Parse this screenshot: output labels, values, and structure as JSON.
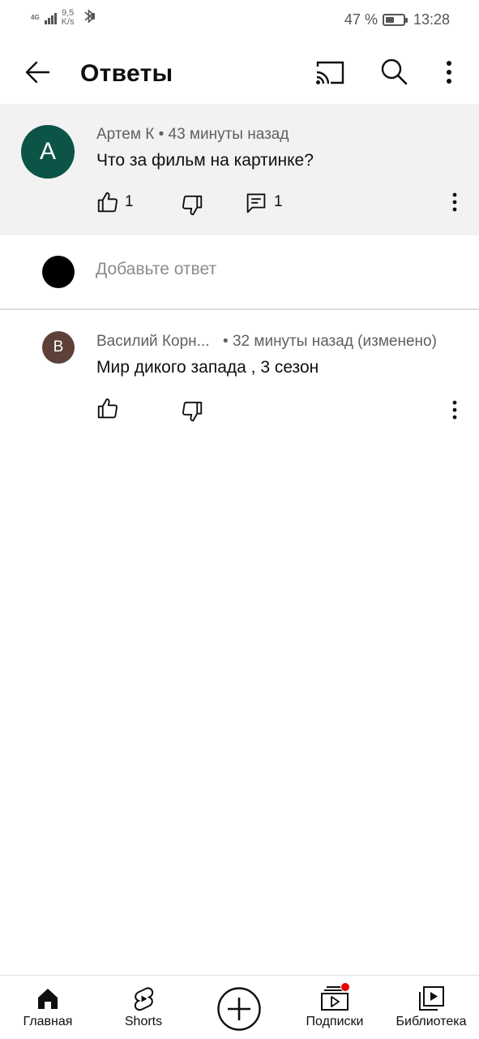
{
  "status_bar": {
    "network": "4G",
    "speed_value": "9,5",
    "speed_unit": "K/s",
    "battery": "47 %",
    "battery_level": 0.47,
    "time": "13:28"
  },
  "app_bar": {
    "title": "Ответы",
    "icons": [
      "back-arrow-icon",
      "cast-icon",
      "search-icon",
      "more-vert-icon"
    ]
  },
  "parent_comment": {
    "avatar_letter": "А",
    "avatar_color": "#0c5447",
    "author": "Артем К",
    "time": "43 минуты назад",
    "text": "Что за фильм на картинке?",
    "likes": "1",
    "replies": "1"
  },
  "reply_box": {
    "placeholder": "Добавьте ответ"
  },
  "replies": [
    {
      "avatar_letter": "В",
      "avatar_color": "#5d4037",
      "author": "Василий Корн...",
      "time": "• 32 минуты назад (изменено)",
      "text": "Мир дикого запада , 3 сезон"
    }
  ],
  "bottom_nav": {
    "items": [
      {
        "label": "Главная",
        "icon": "home-icon"
      },
      {
        "label": "Shorts",
        "icon": "shorts-icon"
      },
      {
        "label": "",
        "icon": "create-plus-icon"
      },
      {
        "label": "Подписки",
        "icon": "subscriptions-icon"
      },
      {
        "label": "Библиотека",
        "icon": "library-icon"
      }
    ],
    "badge_color": "#e60000"
  }
}
